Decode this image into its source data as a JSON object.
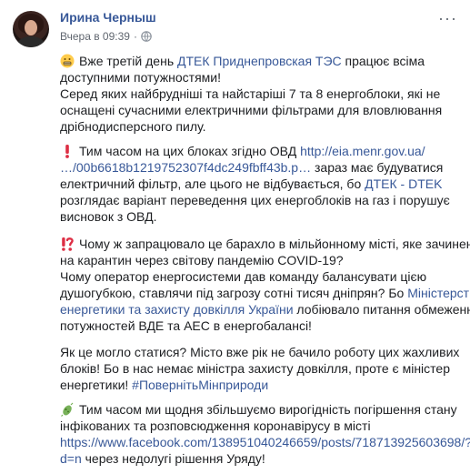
{
  "post": {
    "author": "Ирина Черныш",
    "timestamp": "Вчера в 09:39",
    "more_label": "···"
  },
  "icons": {
    "avatar": "profile-photo",
    "privacy": "globe-icon",
    "more": "ellipsis-icon",
    "p1_emoji": "grimacing-face-icon",
    "p2_emoji": "exclamation-icon",
    "p3_emoji": "interrobang-icon",
    "p5_emoji": "microbe-icon"
  },
  "colors": {
    "link": "#385898",
    "text": "#1c1e21",
    "meta": "#616770",
    "red_mark": "#e0245e"
  },
  "body": {
    "p1": {
      "l1_a": "Вже третій день ",
      "l1_link": "ДТЕК Приднепровская ТЭС",
      "l1_b": " працює всіма",
      "l2": "доступними потужностями!",
      "l3": "Серед яких найбрудніші та найстаріші 7 та 8 енергоблоки, які не",
      "l4": "оснащені сучасними електричними фільтрами для вловлювання",
      "l5": "дрібнодисперсного пилу."
    },
    "p2": {
      "l1_a": "Тим часом на цих блоках згідно ОВД ",
      "l1_link": "http://eia.menr.gov.ua/",
      "l2_link": "…/00b6618b1219752307f4dc249fbff43b.p…",
      "l2_b": " зараз має будуватися",
      "l3_a": "електричний фільтр, але цього не відбувається, бо ",
      "l3_link": "ДТЕК - DTEK",
      "l4": "розглядає варіант переведення цих енергоблоків на газ і порушує",
      "l5": "висновок з ОВД."
    },
    "p3": {
      "l1": "Чому ж запрацювало це барахло в мільйонному місті, яке зачинено",
      "l2": "на карантин через світову пандемію COVID-19?",
      "l3": "Чому оператор енергосистеми дав команду балансувати цією",
      "l4_a": "душогубкою, ставлячи під загрозу сотні тисяч дніпрян? Бо ",
      "l4_link": "Міністерство",
      "l5_link": "енергетики та захисту довкілля України",
      "l5_b": " лобіювало питання обмеження",
      "l6": "потужностей ВДЕ та АЕС в енергобалансі!"
    },
    "p4": {
      "l1": "Як це могло статися? Місто вже рік не бачило роботу цих жахливих",
      "l2": "блоків! Бо в нас немає міністра захисту довкілля, проте є міністер",
      "l3_a": "енергетики! ",
      "l3_link": "#ПовернітьМінприроди"
    },
    "p5": {
      "l1": "Тим часом ми щодня збільшуємо вирогідність погіршення стану",
      "l2": "інфікованих та розповсюдження коронавірусу в місті",
      "l3_link": "https://www.facebook.com/138951040246659/posts/718713925603698/?",
      "l4_link": "d=n",
      "l4_b": " через недолугі рішення Уряду!"
    }
  }
}
